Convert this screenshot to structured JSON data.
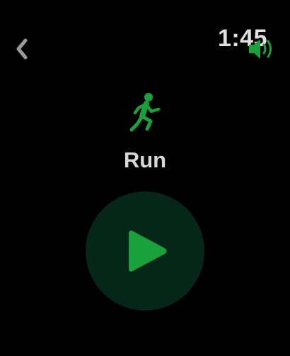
{
  "status_bar": {
    "time": "1:45"
  },
  "workout": {
    "name": "Run"
  },
  "icons": {
    "back": "chevron-left-icon",
    "speaker": "speaker-icon",
    "runner": "running-figure-icon",
    "play": "play-icon"
  },
  "colors": {
    "accent": "#1aa13c",
    "button_bg": "#06261a",
    "text": "#d8d8d8",
    "back_chevron": "#9a9a9a"
  }
}
